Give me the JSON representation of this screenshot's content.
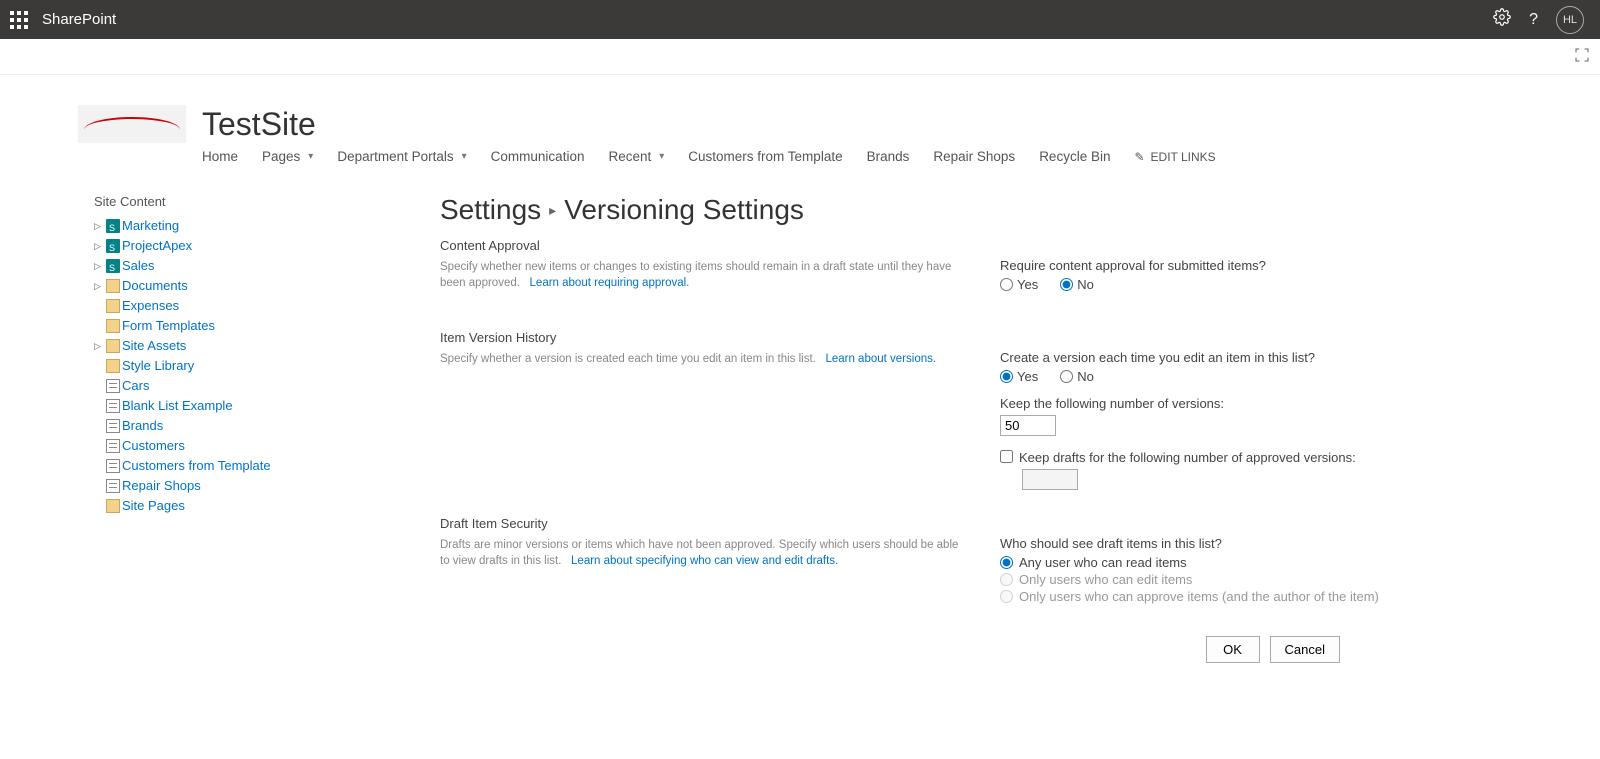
{
  "suite": {
    "app_name": "SharePoint",
    "avatar_initials": "HL"
  },
  "site": {
    "title": "TestSite"
  },
  "top_nav": {
    "items": [
      {
        "label": "Home",
        "dropdown": false
      },
      {
        "label": "Pages",
        "dropdown": true
      },
      {
        "label": "Department Portals",
        "dropdown": true
      },
      {
        "label": "Communication",
        "dropdown": false
      },
      {
        "label": "Recent",
        "dropdown": true
      },
      {
        "label": "Customers from Template",
        "dropdown": false
      },
      {
        "label": "Brands",
        "dropdown": false
      },
      {
        "label": "Repair Shops",
        "dropdown": false
      },
      {
        "label": "Recycle Bin",
        "dropdown": false
      }
    ],
    "edit_links_label": "EDIT LINKS"
  },
  "left_nav": {
    "header": "Site Content",
    "items": [
      {
        "label": "Marketing",
        "icon": "site",
        "has_children": true
      },
      {
        "label": "ProjectApex",
        "icon": "site",
        "has_children": true
      },
      {
        "label": "Sales",
        "icon": "site",
        "has_children": true
      },
      {
        "label": "Documents",
        "icon": "doclib",
        "has_children": true
      },
      {
        "label": "Expenses",
        "icon": "doclib",
        "has_children": false
      },
      {
        "label": "Form Templates",
        "icon": "doclib",
        "has_children": false
      },
      {
        "label": "Site Assets",
        "icon": "doclib",
        "has_children": true
      },
      {
        "label": "Style Library",
        "icon": "doclib",
        "has_children": false
      },
      {
        "label": "Cars",
        "icon": "list",
        "has_children": false
      },
      {
        "label": "Blank List Example",
        "icon": "list",
        "has_children": false
      },
      {
        "label": "Brands",
        "icon": "list",
        "has_children": false
      },
      {
        "label": "Customers",
        "icon": "list",
        "has_children": false
      },
      {
        "label": "Customers from Template",
        "icon": "list",
        "has_children": false
      },
      {
        "label": "Repair Shops",
        "icon": "list",
        "has_children": false
      },
      {
        "label": "Site Pages",
        "icon": "doclib",
        "has_children": false
      }
    ]
  },
  "breadcrumb": {
    "parent": "Settings",
    "current": "Versioning Settings"
  },
  "sections": {
    "content_approval": {
      "title": "Content Approval",
      "desc": "Specify whether new items or changes to existing items should remain in a draft state until they have been approved.",
      "learn_link": "Learn about requiring approval.",
      "question": "Require content approval for submitted items?",
      "yes": "Yes",
      "no": "No",
      "selected": "no"
    },
    "version_history": {
      "title": "Item Version History",
      "desc": "Specify whether a version is created each time you edit an item in this list.",
      "learn_link": "Learn about versions.",
      "question": "Create a version each time you edit an item in this list?",
      "yes": "Yes",
      "no": "No",
      "selected": "yes",
      "keep_versions_label": "Keep the following number of versions:",
      "keep_versions_value": "50",
      "keep_drafts_label": "Keep drafts for the following number of approved versions:",
      "keep_drafts_value": ""
    },
    "draft_security": {
      "title": "Draft Item Security",
      "desc": "Drafts are minor versions or items which have not been approved. Specify which users should be able to view drafts in this list.",
      "learn_link": "Learn about specifying who can view and edit drafts.",
      "question": "Who should see draft items in this list?",
      "opt1": "Any user who can read items",
      "opt2": "Only users who can edit items",
      "opt3": "Only users who can approve items (and the author of the item)",
      "selected": "opt1"
    }
  },
  "buttons": {
    "ok": "OK",
    "cancel": "Cancel"
  }
}
